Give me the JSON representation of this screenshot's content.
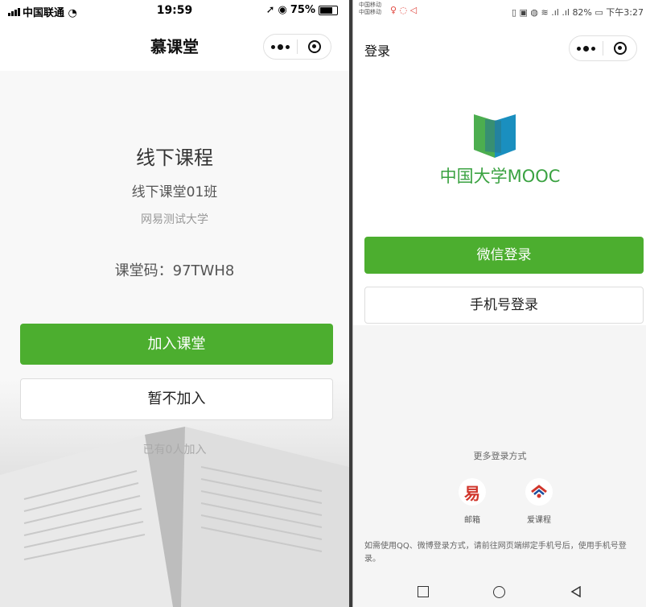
{
  "left_phone": {
    "status": {
      "carrier": "中国联通",
      "time": "19:59",
      "battery": "75%",
      "battery_level": 0.75
    },
    "nav_title": "慕课堂",
    "course_title": "线下课程",
    "class_name": "线下课堂01班",
    "school": "网易测试大学",
    "class_code": "课堂码：97TWH8",
    "join_button": "加入课堂",
    "skip_button": "暂不加入",
    "joined_count": "已有0人加入"
  },
  "right_phone": {
    "status": {
      "carriers": [
        "中国移动",
        "中国移动"
      ],
      "info": "82%",
      "time": "下午3:27"
    },
    "nav_title": "登录",
    "brand": "中国大学MOOC",
    "wechat_login": "微信登录",
    "phone_login": "手机号登录",
    "more_login": "更多登录方式",
    "alt_logins": [
      {
        "label": "邮箱",
        "icon": "netease-mail-icon"
      },
      {
        "label": "爱课程",
        "icon": "icourse-icon"
      }
    ],
    "note": "如需使用QQ、微博登录方式，请前往网页端绑定手机号后，使用手机号登录。"
  },
  "colors": {
    "primary_green": "#4cae2f",
    "brand_green": "#3aa241",
    "logo_teal": "#1a8fbf"
  }
}
